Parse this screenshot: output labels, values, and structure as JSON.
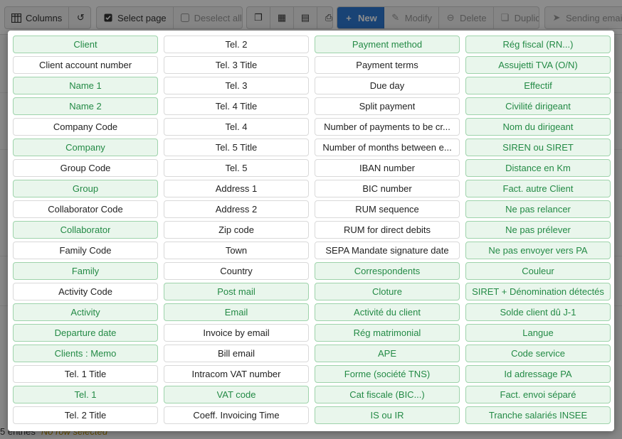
{
  "toolbar": {
    "columns_label": "Columns",
    "select_page_label": "Select page",
    "deselect_all_label": "Deselect all",
    "new_label": "New",
    "modify_label": "Modify",
    "delete_label": "Delete",
    "duplicate_label": "Duplicate",
    "sending_email_label": "Sending email t"
  },
  "background": {
    "entries_text": "5 entries",
    "no_row_selected": "No row selected"
  },
  "column_picker": {
    "columns": [
      [
        {
          "label": "Client",
          "visible": true
        },
        {
          "label": "Client account number",
          "visible": false
        },
        {
          "label": "Name 1",
          "visible": true
        },
        {
          "label": "Name 2",
          "visible": true
        },
        {
          "label": "Company Code",
          "visible": false
        },
        {
          "label": "Company",
          "visible": true
        },
        {
          "label": "Group Code",
          "visible": false
        },
        {
          "label": "Group",
          "visible": true
        },
        {
          "label": "Collaborator Code",
          "visible": false
        },
        {
          "label": "Collaborator",
          "visible": true
        },
        {
          "label": "Family Code",
          "visible": false
        },
        {
          "label": "Family",
          "visible": true
        },
        {
          "label": "Activity Code",
          "visible": false
        },
        {
          "label": "Activity",
          "visible": true
        },
        {
          "label": "Departure date",
          "visible": true
        },
        {
          "label": "Clients : Memo",
          "visible": true
        },
        {
          "label": "Tel. 1 Title",
          "visible": false
        },
        {
          "label": "Tel. 1",
          "visible": true
        },
        {
          "label": "Tel. 2 Title",
          "visible": false
        }
      ],
      [
        {
          "label": "Tel. 2",
          "visible": false
        },
        {
          "label": "Tel. 3 Title",
          "visible": false
        },
        {
          "label": "Tel. 3",
          "visible": false
        },
        {
          "label": "Tel. 4 Title",
          "visible": false
        },
        {
          "label": "Tel. 4",
          "visible": false
        },
        {
          "label": "Tel. 5 Title",
          "visible": false
        },
        {
          "label": "Tel. 5",
          "visible": false
        },
        {
          "label": "Address 1",
          "visible": false
        },
        {
          "label": "Address 2",
          "visible": false
        },
        {
          "label": "Zip code",
          "visible": false
        },
        {
          "label": "Town",
          "visible": false
        },
        {
          "label": "Country",
          "visible": false
        },
        {
          "label": "Post mail",
          "visible": true
        },
        {
          "label": "Email",
          "visible": true
        },
        {
          "label": "Invoice by email",
          "visible": false
        },
        {
          "label": "Bill email",
          "visible": false
        },
        {
          "label": "Intracom VAT number",
          "visible": false
        },
        {
          "label": "VAT code",
          "visible": true
        },
        {
          "label": "Coeff. Invoicing Time",
          "visible": false
        }
      ],
      [
        {
          "label": "Payment method",
          "visible": true
        },
        {
          "label": "Payment terms",
          "visible": false
        },
        {
          "label": "Due day",
          "visible": false
        },
        {
          "label": "Split payment",
          "visible": false
        },
        {
          "label": "Number of payments to be cr...",
          "visible": false
        },
        {
          "label": "Number of months between e...",
          "visible": false
        },
        {
          "label": "IBAN number",
          "visible": false
        },
        {
          "label": "BIC number",
          "visible": false
        },
        {
          "label": "RUM sequence",
          "visible": false
        },
        {
          "label": "RUM for direct debits",
          "visible": false
        },
        {
          "label": "SEPA Mandate signature date",
          "visible": false
        },
        {
          "label": "Correspondents",
          "visible": true
        },
        {
          "label": "Cloture",
          "visible": true
        },
        {
          "label": "Activité du client",
          "visible": true
        },
        {
          "label": "Rég matrimonial",
          "visible": true
        },
        {
          "label": "APE",
          "visible": true
        },
        {
          "label": "Forme (société TNS)",
          "visible": true
        },
        {
          "label": "Cat fiscale (BIC...)",
          "visible": true
        },
        {
          "label": "IS ou IR",
          "visible": true
        }
      ],
      [
        {
          "label": "Rég fiscal (RN...)",
          "visible": true
        },
        {
          "label": "Assujetti TVA (O/N)",
          "visible": true
        },
        {
          "label": "Effectif",
          "visible": true
        },
        {
          "label": "Civilité dirigeant",
          "visible": true
        },
        {
          "label": "Nom du dirigeant",
          "visible": true
        },
        {
          "label": "SIREN ou SIRET",
          "visible": true
        },
        {
          "label": "Distance en Km",
          "visible": true
        },
        {
          "label": "Fact. autre Client",
          "visible": true
        },
        {
          "label": "Ne pas relancer",
          "visible": true
        },
        {
          "label": "Ne pas prélever",
          "visible": true
        },
        {
          "label": "Ne pas envoyer vers PA",
          "visible": true
        },
        {
          "label": "Couleur",
          "visible": true
        },
        {
          "label": "SIRET + Dénomination détectés",
          "visible": true
        },
        {
          "label": "Solde client dû J-1",
          "visible": true
        },
        {
          "label": "Langue",
          "visible": true
        },
        {
          "label": "Code service",
          "visible": true
        },
        {
          "label": "Id adressage PA",
          "visible": true
        },
        {
          "label": "Fact. envoi séparé",
          "visible": true
        },
        {
          "label": "Tranche salariés INSEE",
          "visible": true
        }
      ]
    ]
  }
}
